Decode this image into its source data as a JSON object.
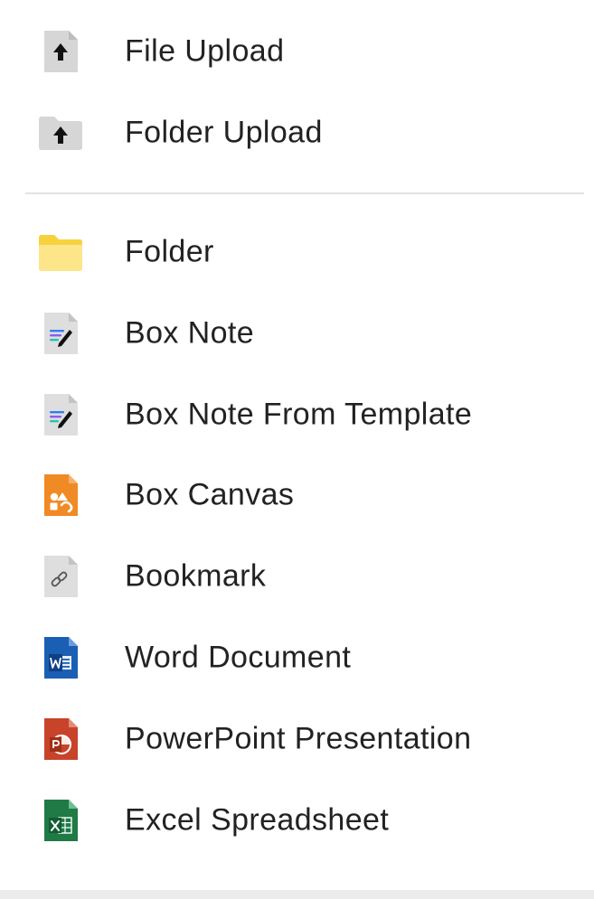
{
  "menu": {
    "upload_items": [
      {
        "label": "File Upload",
        "icon": "file-upload-icon"
      },
      {
        "label": "Folder Upload",
        "icon": "folder-upload-icon"
      }
    ],
    "create_items": [
      {
        "label": "Folder",
        "icon": "folder-icon",
        "color": "#fde68a"
      },
      {
        "label": "Box Note",
        "icon": "box-note-icon"
      },
      {
        "label": "Box Note From Template",
        "icon": "box-note-template-icon"
      },
      {
        "label": "Box Canvas",
        "icon": "box-canvas-icon",
        "color": "#f08a24"
      },
      {
        "label": "Bookmark",
        "icon": "bookmark-icon"
      },
      {
        "label": "Word Document",
        "icon": "word-document-icon",
        "color": "#1a5fb4"
      },
      {
        "label": "PowerPoint Presentation",
        "icon": "powerpoint-icon",
        "color": "#c8432a"
      },
      {
        "label": "Excel Spreadsheet",
        "icon": "excel-icon",
        "color": "#1f7a45"
      }
    ]
  }
}
